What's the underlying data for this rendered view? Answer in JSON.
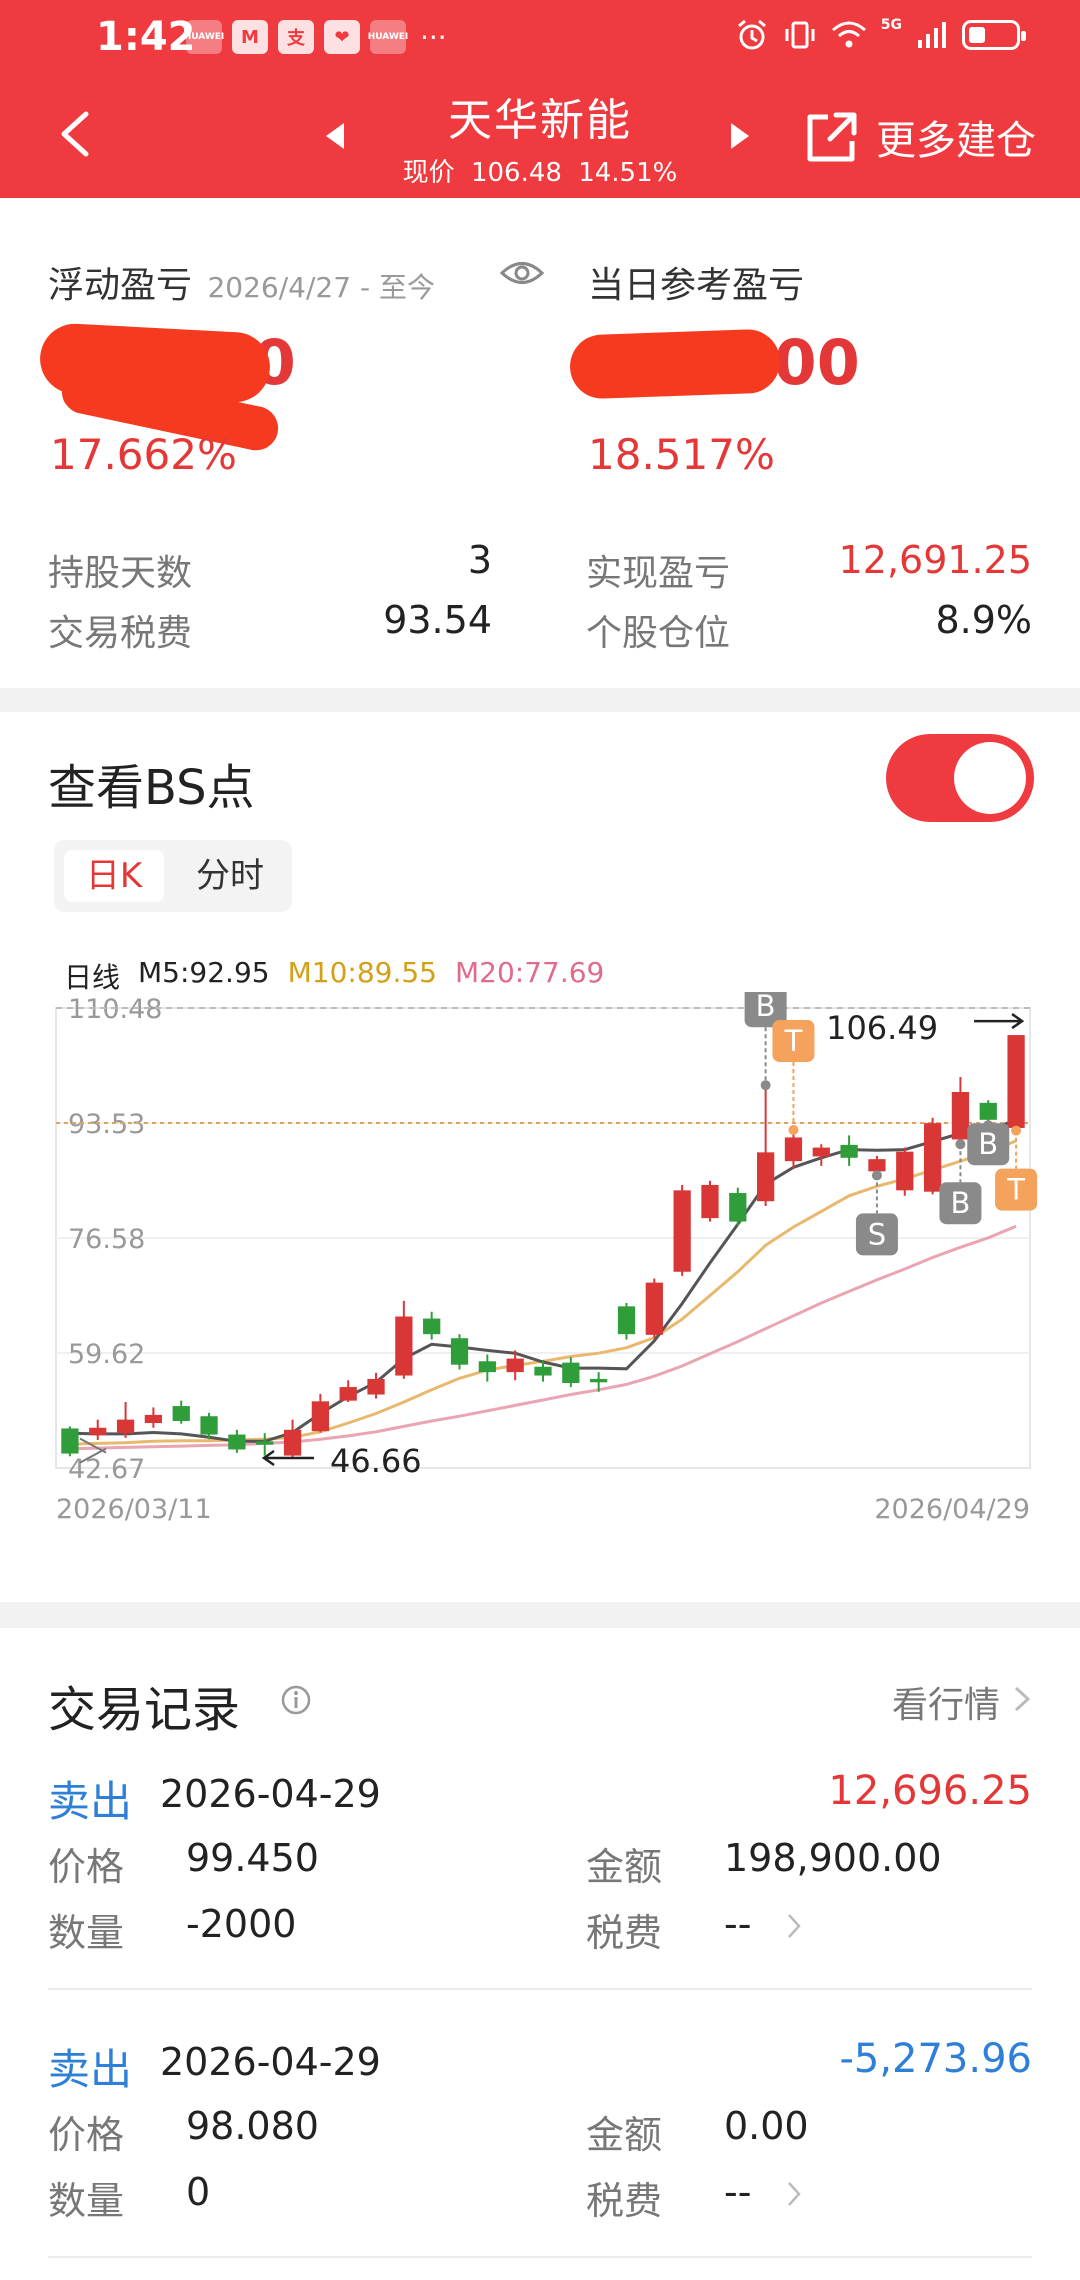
{
  "status_bar": {
    "time": "1:42",
    "apps": [
      "HUAWEI",
      "M",
      "支",
      "❤",
      "HUAWEI"
    ],
    "more": "···",
    "signal": "5G"
  },
  "header": {
    "stock_name": "天华新能",
    "price_label": "现价",
    "price": "106.48",
    "change_pct": "14.51%",
    "more_label": "更多建仓"
  },
  "pl_card": {
    "float_label": "浮动盈亏",
    "float_range": "2026/4/27 - 至今",
    "float_value_visible": ".50",
    "float_pct": "17.662%",
    "day_label": "当日参考盈亏",
    "day_value_visible": ".00",
    "day_pct": "18.517%",
    "stats": [
      {
        "label": "持股天数",
        "value": "3"
      },
      {
        "label": "交易税费",
        "value": "93.54"
      },
      {
        "label": "实现盈亏",
        "value": "12,691.25"
      },
      {
        "label": "个股仓位",
        "value": "8.9%"
      }
    ]
  },
  "bs_card": {
    "title": "查看BS点",
    "tabs": [
      "日K",
      "分时"
    ],
    "active_tab": "日K",
    "ma_label": "日线",
    "m5": "M5:92.95",
    "m10": "M10:89.55",
    "m20": "M20:77.69"
  },
  "chart_data": {
    "type": "candlestick",
    "y_ticks": [
      "110.48",
      "93.53",
      "76.58",
      "59.62",
      "42.67"
    ],
    "ylim": [
      42.67,
      110.48
    ],
    "x_start": "2026/03/11",
    "x_end": "2026/04/29",
    "high_marker": "106.49",
    "low_marker": "46.66",
    "reference_line": 93.53,
    "candles": [
      {
        "o": 48.5,
        "c": 44.8,
        "h": 48.8,
        "l": 44.4
      },
      {
        "o": 47.5,
        "c": 48.6,
        "h": 49.8,
        "l": 46.8
      },
      {
        "o": 47.8,
        "c": 49.8,
        "h": 52.4,
        "l": 47.1
      },
      {
        "o": 49.3,
        "c": 50.5,
        "h": 51.6,
        "l": 48.6
      },
      {
        "o": 51.8,
        "c": 49.6,
        "h": 52.6,
        "l": 49.2
      },
      {
        "o": 50.3,
        "c": 47.6,
        "h": 50.8,
        "l": 46.9
      },
      {
        "o": 47.6,
        "c": 45.4,
        "h": 48.3,
        "l": 44.9
      },
      {
        "o": 46.6,
        "c": 46.1,
        "h": 47.8,
        "l": 44.5
      },
      {
        "o": 44.5,
        "c": 48.3,
        "h": 49.8,
        "l": 44.2
      },
      {
        "o": 48.1,
        "c": 52.5,
        "h": 53.6,
        "l": 47.9
      },
      {
        "o": 52.6,
        "c": 54.6,
        "h": 55.6,
        "l": 52.4
      },
      {
        "o": 53.5,
        "c": 55.8,
        "h": 56.7,
        "l": 52.9
      },
      {
        "o": 56.3,
        "c": 65.0,
        "h": 67.3,
        "l": 55.8
      },
      {
        "o": 64.7,
        "c": 62.4,
        "h": 65.7,
        "l": 61.6
      },
      {
        "o": 61.8,
        "c": 57.9,
        "h": 62.4,
        "l": 57.2
      },
      {
        "o": 58.4,
        "c": 56.8,
        "h": 59.4,
        "l": 55.4
      },
      {
        "o": 56.8,
        "c": 58.8,
        "h": 60.0,
        "l": 55.6
      },
      {
        "o": 57.6,
        "c": 56.3,
        "h": 58.6,
        "l": 55.4
      },
      {
        "o": 58.2,
        "c": 55.2,
        "h": 59.0,
        "l": 54.6
      },
      {
        "o": 55.8,
        "c": 55.3,
        "h": 56.8,
        "l": 53.9
      },
      {
        "o": 66.5,
        "c": 62.4,
        "h": 67.0,
        "l": 61.6
      },
      {
        "o": 62.3,
        "c": 70.0,
        "h": 70.6,
        "l": 61.8
      },
      {
        "o": 71.6,
        "c": 83.6,
        "h": 84.4,
        "l": 71.0
      },
      {
        "o": 79.5,
        "c": 84.4,
        "h": 85.0,
        "l": 79.0
      },
      {
        "o": 83.2,
        "c": 79.0,
        "h": 84.0,
        "l": 78.4
      },
      {
        "o": 82.0,
        "c": 89.2,
        "h": 99.1,
        "l": 81.3
      },
      {
        "o": 87.9,
        "c": 91.4,
        "h": 92.5,
        "l": 86.8
      },
      {
        "o": 88.6,
        "c": 89.9,
        "h": 90.4,
        "l": 87.2
      },
      {
        "o": 90.3,
        "c": 88.4,
        "h": 91.7,
        "l": 87.2
      },
      {
        "o": 86.4,
        "c": 88.2,
        "h": 88.7,
        "l": 85.8
      },
      {
        "o": 83.6,
        "c": 89.3,
        "h": 89.9,
        "l": 82.8
      },
      {
        "o": 83.4,
        "c": 93.5,
        "h": 94.3,
        "l": 83.0
      },
      {
        "o": 91.1,
        "c": 98.1,
        "h": 100.3,
        "l": 90.4
      },
      {
        "o": 96.5,
        "c": 94.0,
        "h": 96.9,
        "l": 93.2
      },
      {
        "o": 92.8,
        "c": 106.49,
        "h": 106.49,
        "l": 92.4
      }
    ],
    "ma5": [
      47.8,
      47.7,
      47.7,
      47.9,
      47.7,
      47.2,
      46.6,
      46.6,
      47.9,
      50.7,
      53.2,
      55.3,
      58.8,
      60.9,
      60.5,
      60.0,
      59.6,
      58.3,
      57.4,
      57.4,
      57.3,
      61.4,
      66.9,
      72.9,
      78.6,
      84.5,
      87.0,
      88.4,
      89.6,
      89.5,
      89.6,
      90.8,
      92.0,
      92.4,
      94.0
    ],
    "ma10": [
      46.2,
      46.3,
      46.4,
      46.6,
      46.7,
      46.7,
      46.8,
      46.9,
      47.2,
      48.0,
      49.3,
      50.7,
      52.4,
      54.2,
      55.9,
      57.1,
      57.8,
      58.4,
      59.1,
      59.6,
      60.4,
      61.9,
      64.6,
      68.1,
      71.6,
      75.5,
      78.2,
      80.5,
      82.8,
      84.2,
      85.3,
      86.6,
      87.9,
      89.2,
      90.9
    ],
    "ma20": [
      45.5,
      45.6,
      45.7,
      45.8,
      45.9,
      46.0,
      46.1,
      46.3,
      46.5,
      46.9,
      47.4,
      48.0,
      48.8,
      49.6,
      50.3,
      51.1,
      51.9,
      52.7,
      53.5,
      54.2,
      55.0,
      56.2,
      57.7,
      59.5,
      61.3,
      63.2,
      65.1,
      67.0,
      68.7,
      70.4,
      72.0,
      73.7,
      75.2,
      76.6,
      78.3
    ],
    "bs_points": [
      {
        "label": "B",
        "index": 25,
        "pos": "above"
      },
      {
        "label": "T",
        "index": 26,
        "pos": "above"
      },
      {
        "label": "S",
        "index": 29,
        "pos": "below"
      },
      {
        "label": "B",
        "index": 32,
        "pos": "below"
      },
      {
        "label": "B",
        "index": 33,
        "pos": "below"
      },
      {
        "label": "T",
        "index": 34,
        "pos": "below"
      }
    ]
  },
  "trades": {
    "title": "交易记录",
    "link": "看行情",
    "records": [
      {
        "type": "卖出",
        "date": "2026-04-29",
        "pl": "12,696.25",
        "pl_color": "red",
        "price_label": "价格",
        "price": "99.450",
        "amount_label": "金额",
        "amount": "198,900.00",
        "qty_label": "数量",
        "qty": "-2000",
        "fee_label": "税费",
        "fee": "--"
      },
      {
        "type": "卖出",
        "date": "2026-04-29",
        "pl": "-5,273.96",
        "pl_color": "blue",
        "price_label": "价格",
        "price": "98.080",
        "amount_label": "金额",
        "amount": "0.00",
        "qty_label": "数量",
        "qty": "0",
        "fee_label": "税费",
        "fee": "--"
      }
    ]
  },
  "colors": {
    "brand_red": "#ef3a3f",
    "up": "#d93636",
    "down": "#2e9d3a",
    "blue": "#2d7fd8",
    "ma5": "#555555",
    "ma10": "#e8b86d",
    "ma20": "#eaa4b2"
  }
}
